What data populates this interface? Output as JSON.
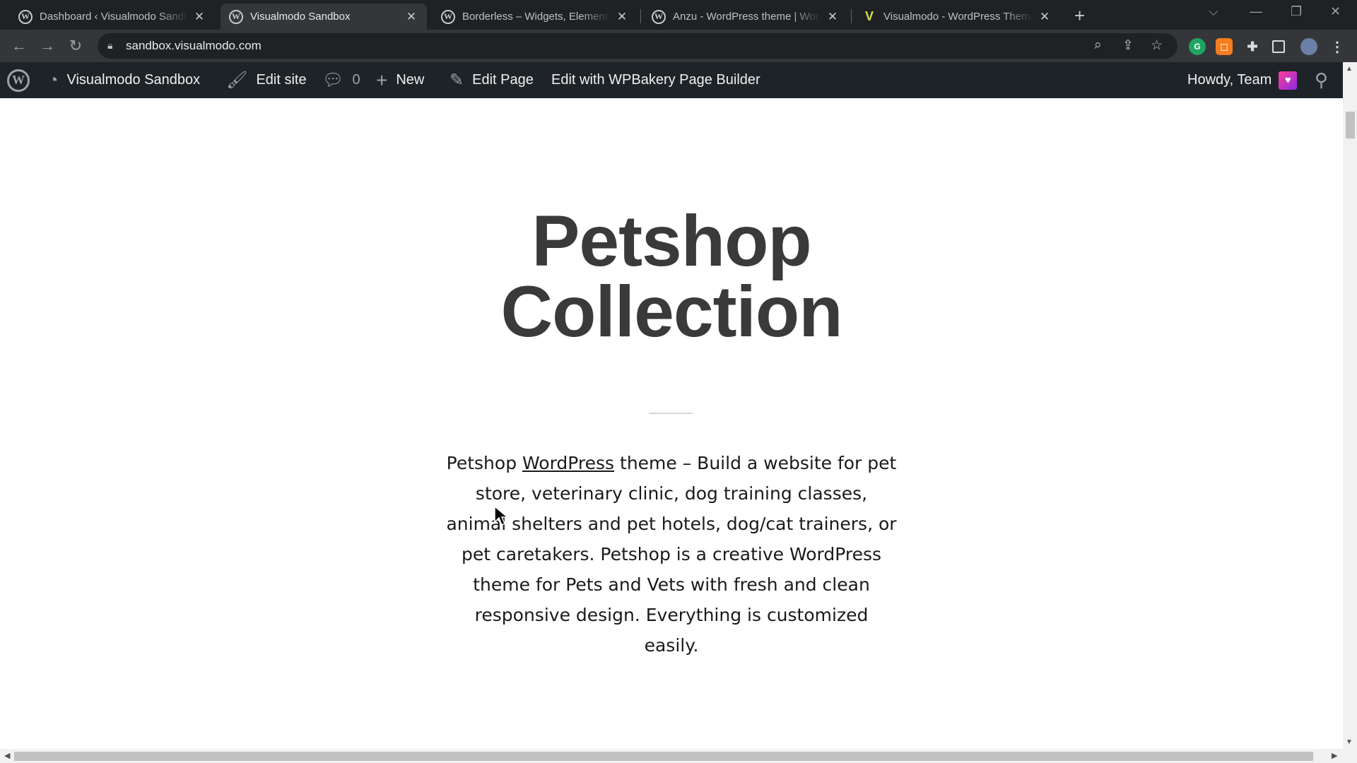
{
  "browser": {
    "tabs": [
      {
        "title": "Dashboard ‹ Visualmodo Sandbox",
        "icon": "wordpress-icon",
        "active": false
      },
      {
        "title": "Visualmodo Sandbox",
        "icon": "wordpress-icon",
        "active": true
      },
      {
        "title": "Borderless – Widgets, Elements, Templates",
        "icon": "wordpress-icon",
        "active": false
      },
      {
        "title": "Anzu - WordPress theme | WordPress",
        "icon": "wordpress-icon",
        "active": false
      },
      {
        "title": "Visualmodo - WordPress Themes",
        "icon": "visualmodo-icon",
        "active": false
      }
    ],
    "url": "sandbox.visualmodo.com"
  },
  "adminbar": {
    "site_name": "Visualmodo Sandbox",
    "edit_site": "Edit site",
    "comments_count": "0",
    "new_label": "New",
    "edit_page": "Edit Page",
    "wpbakery": "Edit with WPBakery Page Builder",
    "howdy": "Howdy, Team"
  },
  "content": {
    "title_line1": "Petshop",
    "title_line2": "Collection",
    "desc_before_link": "Petshop ",
    "desc_link": "WordPress",
    "desc_after_link": " theme – Build a website for pet store, veterinary clinic, dog training classes, animal shelters and pet hotels, dog/cat trainers, or pet caretakers. Petshop is a creative WordPress theme for Pets and Vets with fresh and clean responsive design. Everything is customized easily."
  },
  "colors": {
    "adminbar_bg": "#1d2327",
    "title_color": "#3a3a3a",
    "tabstrip_bg": "#202124"
  }
}
